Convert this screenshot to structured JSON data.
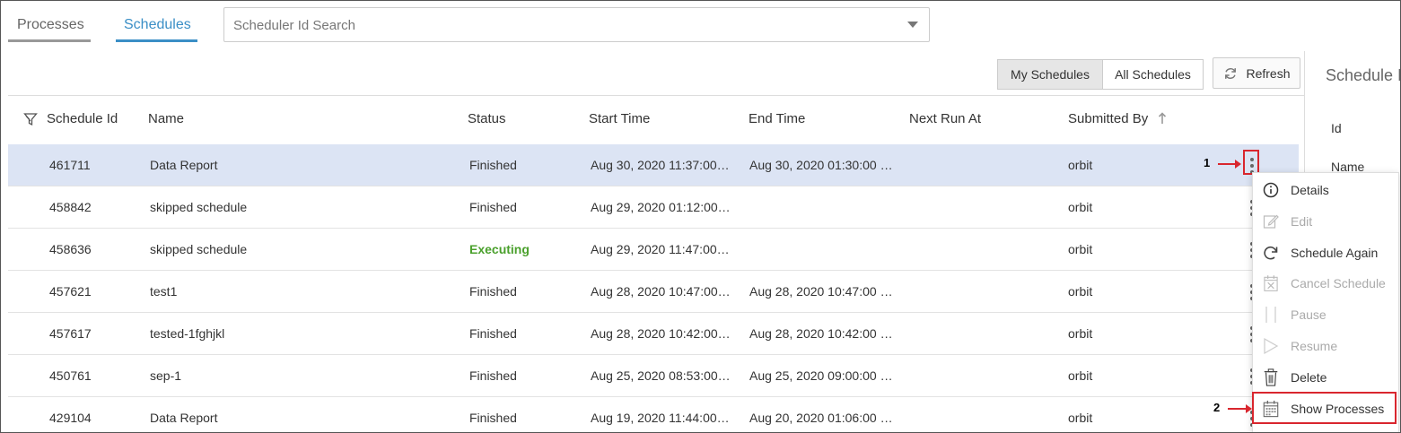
{
  "tabs": [
    {
      "label": "Processes",
      "active": false
    },
    {
      "label": "Schedules",
      "active": true
    }
  ],
  "search": {
    "placeholder": "Scheduler Id Search"
  },
  "toolbar": {
    "my_schedules": "My Schedules",
    "all_schedules": "All Schedules",
    "refresh": "Refresh"
  },
  "side_panel": {
    "title": "Schedule I",
    "fields": [
      "Id",
      "Name"
    ]
  },
  "table": {
    "columns": [
      "Schedule Id",
      "Name",
      "Status",
      "Start Time",
      "End Time",
      "Next Run At",
      "Submitted By"
    ],
    "rows": [
      {
        "id": "461711",
        "name": "Data Report",
        "status": "Finished",
        "start": "Aug 30, 2020 11:37:00…",
        "end": "Aug 30, 2020 01:30:00 …",
        "next": "",
        "by": "orbit"
      },
      {
        "id": "458842",
        "name": "skipped schedule",
        "status": "Finished",
        "start": "Aug 29, 2020 01:12:00…",
        "end": "",
        "next": "",
        "by": "orbit"
      },
      {
        "id": "458636",
        "name": "skipped schedule",
        "status": "Executing",
        "start": "Aug 29, 2020 11:47:00…",
        "end": "",
        "next": "",
        "by": "orbit"
      },
      {
        "id": "457621",
        "name": "test1",
        "status": "Finished",
        "start": "Aug 28, 2020 10:47:00…",
        "end": "Aug 28, 2020 10:47:00 …",
        "next": "",
        "by": "orbit"
      },
      {
        "id": "457617",
        "name": "tested-1fghjkl",
        "status": "Finished",
        "start": "Aug 28, 2020 10:42:00…",
        "end": "Aug 28, 2020 10:42:00 …",
        "next": "",
        "by": "orbit"
      },
      {
        "id": "450761",
        "name": "sep-1",
        "status": "Finished",
        "start": "Aug 25, 2020 08:53:00…",
        "end": "Aug 25, 2020 09:00:00 …",
        "next": "",
        "by": "orbit"
      },
      {
        "id": "429104",
        "name": "Data Report",
        "status": "Finished",
        "start": "Aug 19, 2020 11:44:00…",
        "end": "Aug 20, 2020 01:06:00 …",
        "next": "",
        "by": "orbit"
      }
    ]
  },
  "context_menu": {
    "items": [
      {
        "label": "Details",
        "icon": "info-icon",
        "enabled": true
      },
      {
        "label": "Edit",
        "icon": "edit-icon",
        "enabled": false
      },
      {
        "label": "Schedule Again",
        "icon": "redo-icon",
        "enabled": true
      },
      {
        "label": "Cancel Schedule",
        "icon": "calendar-cancel-icon",
        "enabled": false
      },
      {
        "label": "Pause",
        "icon": "pause-icon",
        "enabled": false
      },
      {
        "label": "Resume",
        "icon": "play-icon",
        "enabled": false
      },
      {
        "label": "Delete",
        "icon": "trash-icon",
        "enabled": true
      },
      {
        "label": "Show Processes",
        "icon": "calendar-icon",
        "enabled": true
      }
    ]
  },
  "annotations": [
    "1",
    "2"
  ],
  "colors": {
    "accent": "#3b8fc6",
    "selected_row": "#dce4f4",
    "executing": "#4aa02c",
    "annotation": "#d9262e"
  }
}
